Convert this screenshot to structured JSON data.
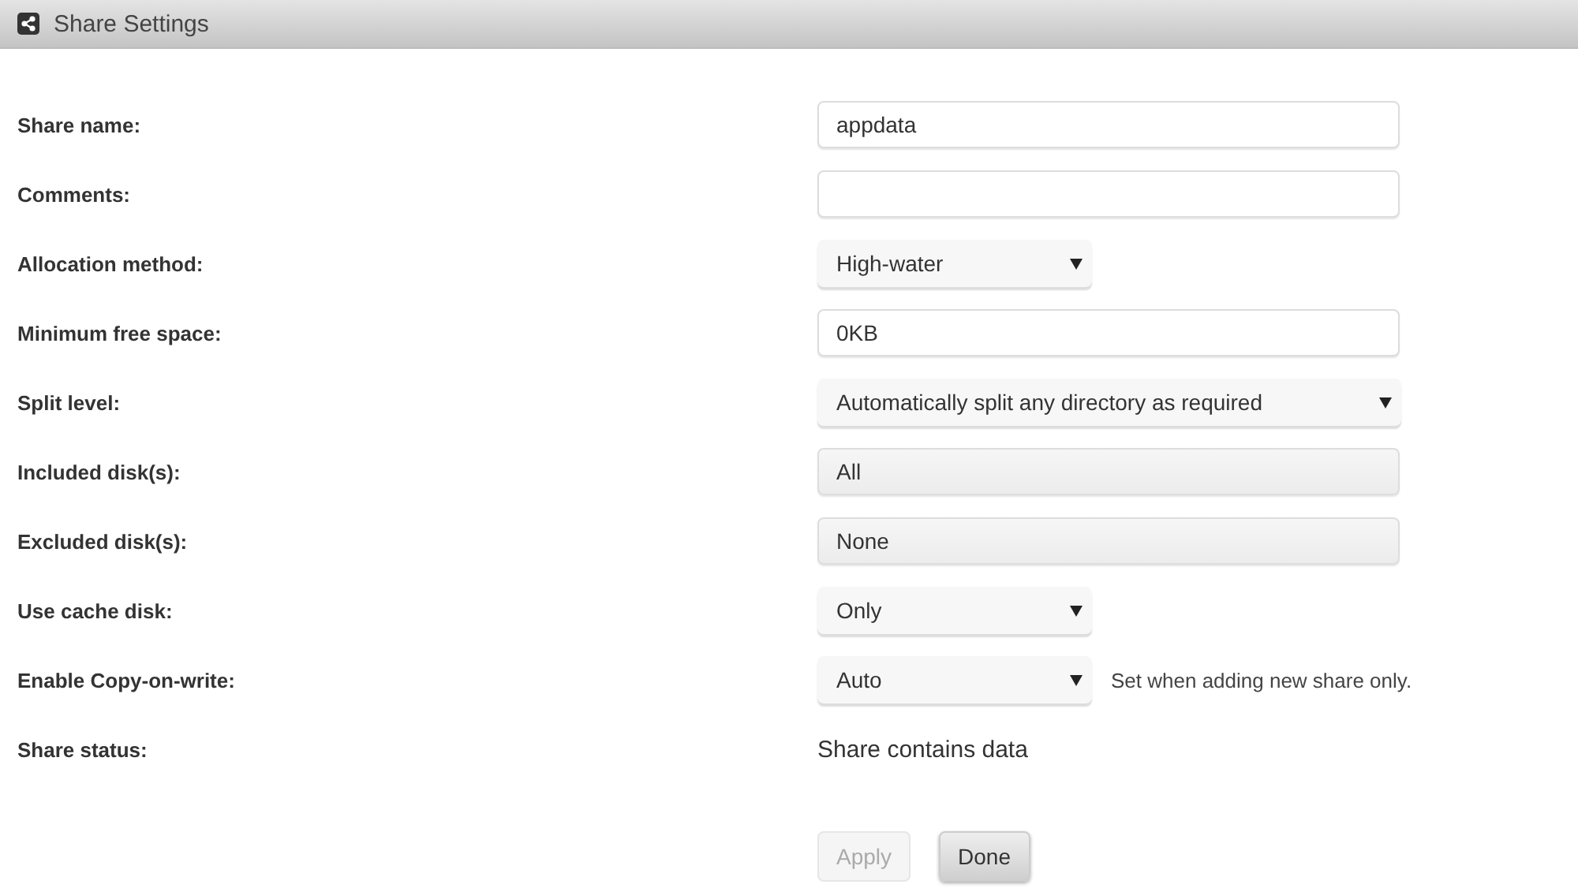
{
  "header": {
    "title": "Share Settings"
  },
  "rows": [
    {
      "label": "Share name:",
      "kind": "input",
      "value": "appdata"
    },
    {
      "label": "Comments:",
      "kind": "input"
    },
    {
      "label": "Allocation method:",
      "kind": "dropdown",
      "value": "High-water"
    },
    {
      "label": "Minimum free space:",
      "kind": "input",
      "value": "0KB"
    },
    {
      "label": "Split level:",
      "kind": "long-dropdown",
      "value": "Automatically split any directory as required"
    },
    {
      "label": "Included disk(s):",
      "kind": "readonly",
      "value": "All"
    },
    {
      "label": "Excluded disk(s):",
      "kind": "readonly",
      "value": "None"
    },
    {
      "label": "Use cache disk:",
      "kind": "dropdown",
      "value": "Only"
    },
    {
      "label": "Enable Copy-on-write:",
      "kind": "dropdown",
      "value": "Auto",
      "note": "Set when adding new share only."
    },
    {
      "label": "Share status:",
      "kind": "status",
      "value": "Share contains data"
    }
  ],
  "buttons": [
    {
      "label": "Apply",
      "disabled": true
    },
    {
      "label": "Done",
      "disabled": false
    }
  ]
}
